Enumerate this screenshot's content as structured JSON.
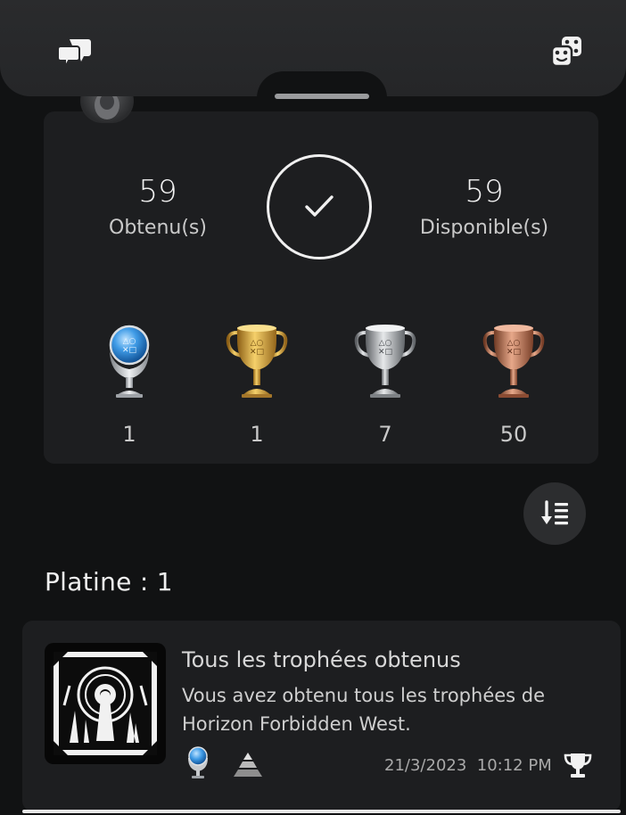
{
  "summary": {
    "earned": {
      "value": "59",
      "label": "Obtenu(s)"
    },
    "available": {
      "value": "59",
      "label": "Disponible(s)"
    },
    "trophies": {
      "platinum": "1",
      "gold": "1",
      "silver": "7",
      "bronze": "50"
    }
  },
  "section": {
    "title": "Platine : 1"
  },
  "trophy_item": {
    "title": "Tous les trophées obtenus",
    "description": "Vous avez obtenu tous les trophées de Horizon Forbidden West.",
    "date": "21/3/2023",
    "time": "10:12 PM"
  },
  "icons": {
    "top_left": "chat-bubbles-icon",
    "top_right": "game-dice-icon",
    "sort": "sort-icon",
    "rarity": "rarity-pyramid-icon",
    "trophy": "trophy-icon"
  },
  "colors": {
    "platinum": "#3f9be6",
    "gold": "#d9a93c",
    "silver": "#b9bcc0",
    "bronze": "#c98060"
  }
}
